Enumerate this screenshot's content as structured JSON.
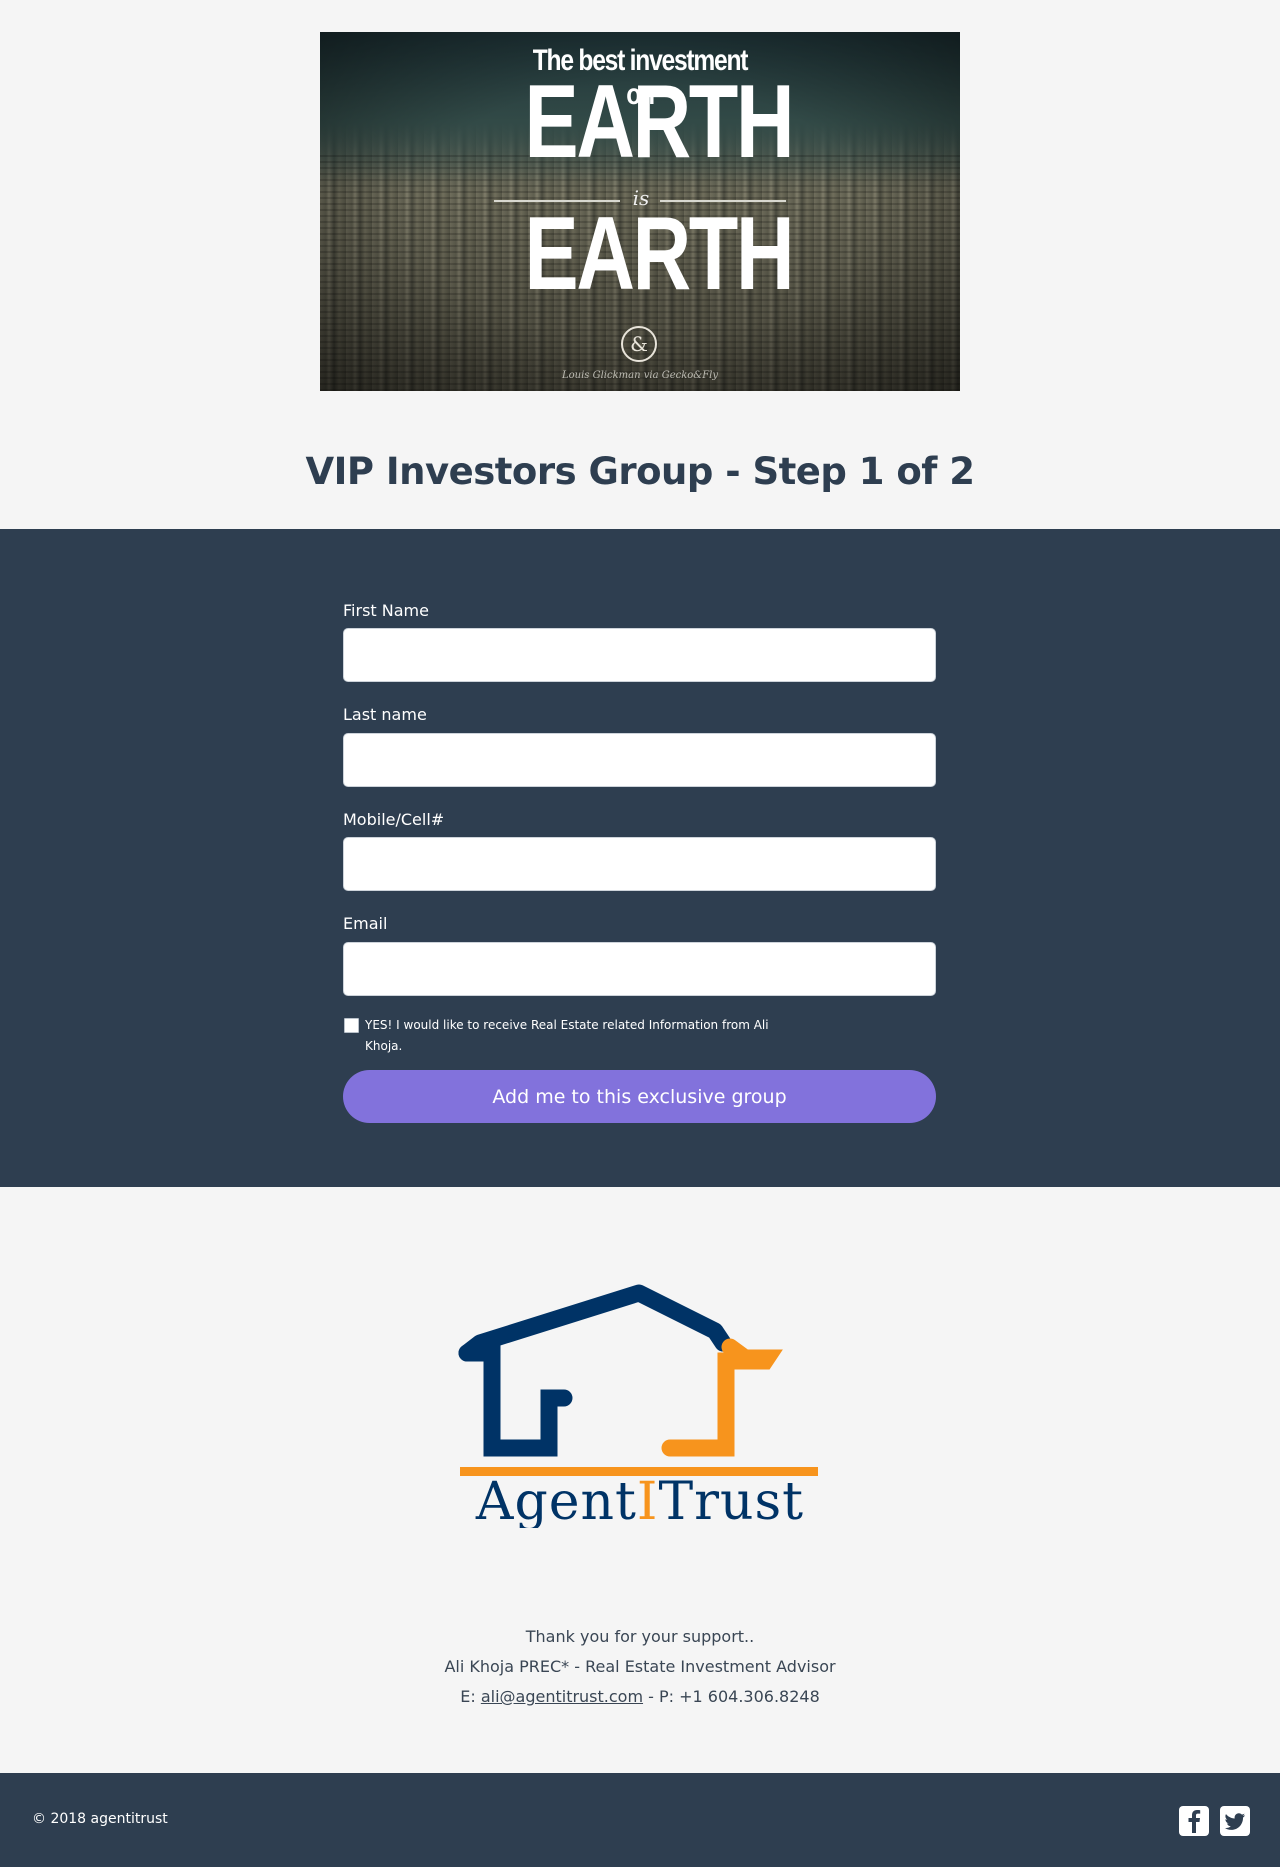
{
  "hero": {
    "line1": "The best investment on",
    "earth1": "EARTH",
    "connector": "is",
    "earth2": "EARTH",
    "emblem": "&",
    "signature": "Louis Glickman via Gecko&Fly"
  },
  "page": {
    "title": "VIP Investors Group - Step 1 of 2"
  },
  "form": {
    "fields": [
      {
        "label": "First Name",
        "value": "",
        "placeholder": ""
      },
      {
        "label": "Last name",
        "value": "",
        "placeholder": ""
      },
      {
        "label": "Mobile/Cell#",
        "value": "",
        "placeholder": ""
      },
      {
        "label": "Email",
        "value": "",
        "placeholder": ""
      }
    ],
    "consent": {
      "checked": false,
      "text": "YES! I would like to receive Real Estate related Information from Ali Khoja."
    },
    "submit_label": "Add me to this exclusive group"
  },
  "brand": {
    "name_part1": "Agent",
    "name_part2": "I",
    "name_part3": "Trust",
    "colors": {
      "navy": "#003366",
      "orange": "#f7941d"
    }
  },
  "contact": {
    "thanks": "Thank you for your support..",
    "advisor": "Ali Khoja PREC* - Real Estate Investment Advisor",
    "email_prefix": "E: ",
    "email": "ali@agentitrust.com",
    "phone_text": " - P: +1 604.306.8248"
  },
  "footer": {
    "copyright": "© 2018 agentitrust",
    "social": [
      {
        "name": "facebook",
        "icon": "facebook-icon"
      },
      {
        "name": "twitter",
        "icon": "twitter-icon"
      }
    ]
  },
  "theme": {
    "dark": "#2e3e50",
    "light": "#f5f5f5",
    "accent": "#8272dc"
  }
}
